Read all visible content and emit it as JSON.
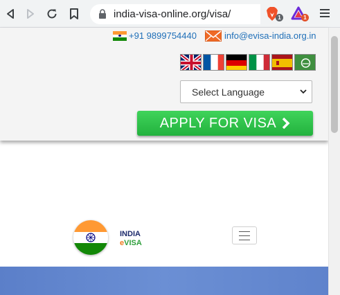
{
  "browser": {
    "url": "india-visa-online.org/visa/",
    "brave_badge": "1",
    "rewards_badge": "1"
  },
  "contact": {
    "phone": "+91 9899754440",
    "email": "info@evisa-india.org.in"
  },
  "languages": {
    "flags": [
      "uk-flag",
      "france-flag",
      "germany-flag",
      "italy-flag",
      "spain-flag",
      "arabic-flag"
    ],
    "select_label": "Select Language"
  },
  "cta": {
    "apply_label": "APPLY FOR VISA"
  },
  "logo": {
    "line1": "INDIA",
    "line2_prefix": "e",
    "line2_rest": "VISA"
  },
  "colors": {
    "apply_green": "#2ec44a",
    "link_blue": "#1f6fb8",
    "hero_blue": "#6b8fd4",
    "saffron": "#ff9933",
    "india_green": "#138808"
  }
}
